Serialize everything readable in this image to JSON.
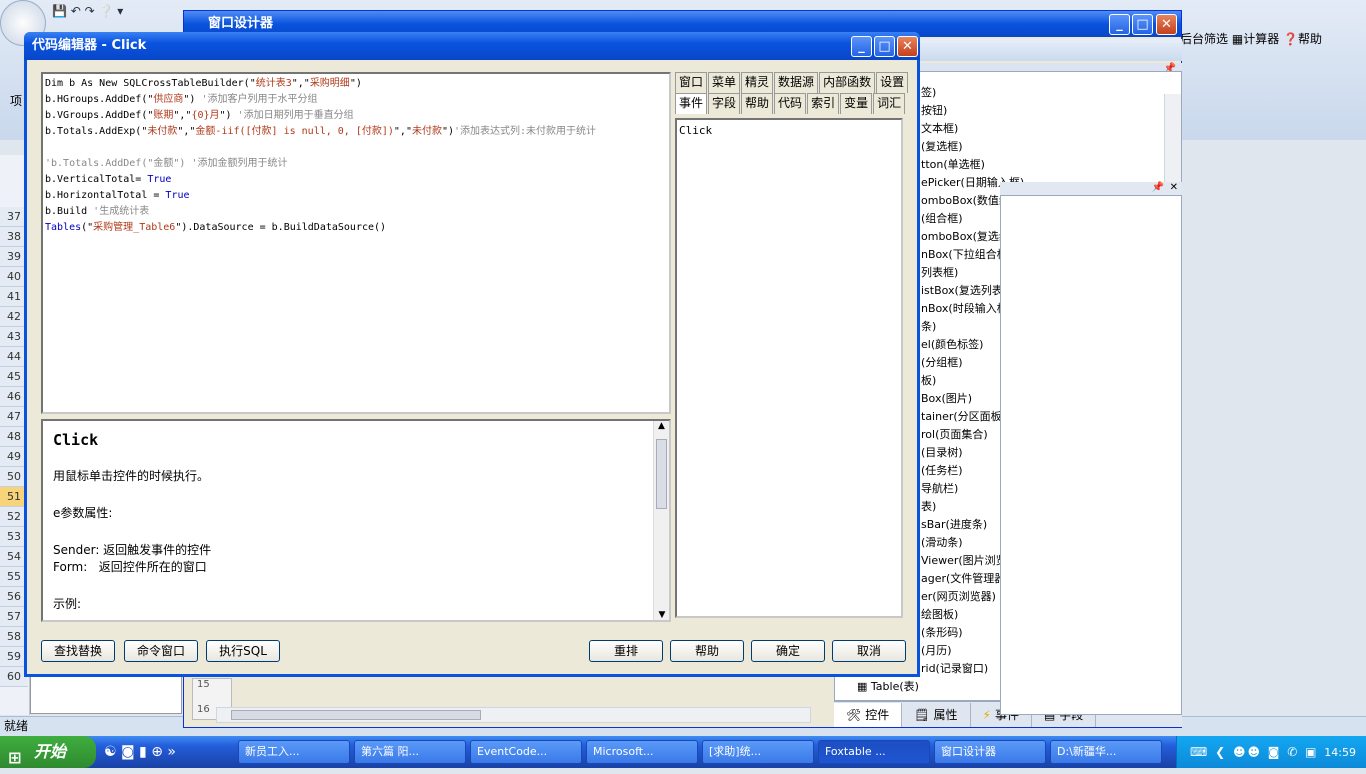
{
  "designer": {
    "title": "窗口设计器",
    "tree_items": [
      "签)",
      "按钮)",
      "文本框)",
      "(复选框)",
      "tton(单选框)",
      "ePicker(日期输入框)",
      "omboBox(数值组合框)",
      "(组合框)",
      "omboBox(复选组合框)",
      "nBox(下拉组合框)",
      "列表框)",
      "istBox(复选列表框)",
      "nBox(时段输入框)",
      "条)",
      "el(颜色标签)",
      "(分组框)",
      "板)",
      "Box(图片)",
      "tainer(分区面板)",
      "rol(页面集合)",
      "(目录树)",
      "(任务栏)",
      "导航栏)",
      "表)",
      "sBar(进度条)",
      "(滑动条)",
      "Viewer(图片浏览器)",
      "ager(文件管理器)",
      "er(网页浏览器)",
      "绘图板)",
      "(条形码)",
      "(月历)",
      "rid(记录窗口)",
      "Table(表)"
    ],
    "bottom_tabs": [
      "控件",
      "属性",
      "事件",
      "字段"
    ]
  },
  "background": {
    "row_numbers": [
      "37",
      "38",
      "39",
      "40",
      "41",
      "42",
      "43",
      "44",
      "45",
      "46",
      "47",
      "48",
      "49",
      "50",
      "51",
      "52",
      "53",
      "54",
      "55",
      "56",
      "57",
      "58",
      "59",
      "60"
    ],
    "selected_row": "51",
    "left_label": "项",
    "status": "就绪",
    "ribbon_items": [
      "后台筛选",
      "计算器",
      "帮助"
    ],
    "line_15": "15",
    "line_16": "16"
  },
  "editor": {
    "title": "代码编辑器 - Click",
    "code_lines": [
      [
        {
          "t": "Dim b As New SQLCrossTableBuilder(\""
        },
        {
          "s": "统计表3"
        },
        {
          "t": "\",\""
        },
        {
          "s": "采购明细"
        },
        {
          "t": "\")"
        }
      ],
      [
        {
          "t": "b.HGroups.AddDef(\""
        },
        {
          "s": "供应商"
        },
        {
          "t": "\") "
        },
        {
          "c": "'添加客户列用于水平分组"
        }
      ],
      [
        {
          "t": "b.VGroups.AddDef(\""
        },
        {
          "s": "账期"
        },
        {
          "t": "\",\""
        },
        {
          "s": "{0}月"
        },
        {
          "t": "\") "
        },
        {
          "c": "'添加日期列用于垂直分组"
        }
      ],
      [
        {
          "t": "b.Totals.AddExp(\""
        },
        {
          "s": "未付款"
        },
        {
          "t": "\",\""
        },
        {
          "s": "金额-iif([付款] is null, 0, [付款])"
        },
        {
          "t": "\",\""
        },
        {
          "s": "未付款"
        },
        {
          "t": "\")"
        },
        {
          "c": "'添加表达式列:未付款用于统计"
        }
      ],
      [],
      [
        {
          "c": "'b.Totals.AddDef(\"金额\") '添加金额列用于统计"
        }
      ],
      [
        {
          "t": "b.VerticalTotal= "
        },
        {
          "k": "True"
        }
      ],
      [
        {
          "t": "b.HorizontalTotal = "
        },
        {
          "k": "True"
        }
      ],
      [
        {
          "t": "b.Build "
        },
        {
          "c": "'生成统计表"
        }
      ],
      [
        {
          "k": "Tables"
        },
        {
          "t": "(\""
        },
        {
          "s": "采购管理_Table6"
        },
        {
          "t": "\").DataSource = b.BuildDataSource()"
        }
      ]
    ],
    "help": {
      "heading": "Click",
      "desc": "用鼠标单击控件的时候执行。",
      "params_title": "e参数属性:",
      "sender": "Sender: 返回触发事件的控件",
      "form": "Form:   返回控件所在的窗口",
      "example": "示例:"
    },
    "tabs_row1": [
      "窗口",
      "菜单",
      "精灵",
      "数据源",
      "内部函数",
      "设置"
    ],
    "tabs_row2": [
      "事件",
      "字段",
      "帮助",
      "代码",
      "索引",
      "变量",
      "词汇"
    ],
    "event_item": "Click",
    "buttons": {
      "find_replace": "查找替换",
      "command_window": "命令窗口",
      "exec_sql": "执行SQL",
      "rearrange": "重排",
      "help": "帮助",
      "ok": "确定",
      "cancel": "取消"
    }
  },
  "taskbar": {
    "start": "开始",
    "tasks": [
      "新员工入...",
      "第六篇 阳...",
      "EventCode...",
      "Microsoft...",
      "[求助]统...",
      "Foxtable ...",
      "窗口设计器",
      "D:\\新疆华..."
    ],
    "time": "14:59"
  },
  "colors": {
    "title_blue": "#0a53de",
    "code_string": "#b03a1a",
    "code_comment": "#888888",
    "code_keyword": "#0000c0"
  }
}
